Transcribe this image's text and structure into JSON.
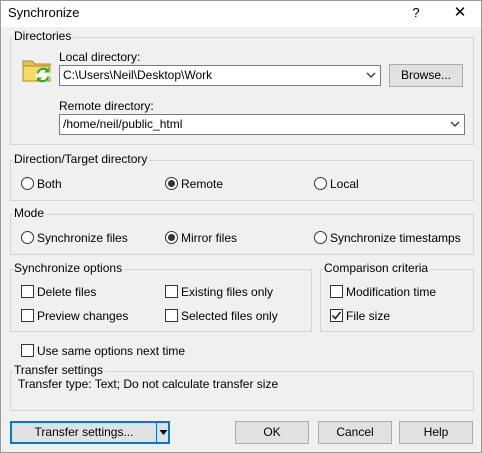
{
  "window": {
    "title": "Synchronize",
    "help_glyph": "?",
    "close_glyph": "✕"
  },
  "directories": {
    "group_label": "Directories",
    "local_label": "Local directory:",
    "local_value": "C:\\Users\\Neil\\Desktop\\Work",
    "browse_label": "Browse...",
    "remote_label": "Remote directory:",
    "remote_value": "/home/neil/public_html"
  },
  "direction": {
    "group_label": "Direction/Target directory",
    "options": [
      {
        "label": "Both",
        "selected": false
      },
      {
        "label": "Remote",
        "selected": true
      },
      {
        "label": "Local",
        "selected": false
      }
    ]
  },
  "mode": {
    "group_label": "Mode",
    "options": [
      {
        "label": "Synchronize files",
        "selected": false
      },
      {
        "label": "Mirror files",
        "selected": true
      },
      {
        "label": "Synchronize timestamps",
        "selected": false
      }
    ]
  },
  "sync_options": {
    "group_label": "Synchronize options",
    "items": [
      {
        "label": "Delete files",
        "checked": false
      },
      {
        "label": "Existing files only",
        "checked": false
      },
      {
        "label": "Preview changes",
        "checked": false
      },
      {
        "label": "Selected files only",
        "checked": false
      }
    ]
  },
  "comparison": {
    "group_label": "Comparison criteria",
    "items": [
      {
        "label": "Modification time",
        "checked": false
      },
      {
        "label": "File size",
        "checked": true
      }
    ]
  },
  "same_options": {
    "label": "Use same options next time",
    "checked": false
  },
  "transfer_settings": {
    "group_label": "Transfer settings",
    "text": "Transfer type: Text; Do not calculate transfer size"
  },
  "footer": {
    "transfer_button": "Transfer settings...",
    "ok": "OK",
    "cancel": "Cancel",
    "help": "Help"
  },
  "icons": {
    "folder": "folder-sync-icon",
    "combo_arrow": "chevron-down-icon"
  },
  "colors": {
    "accent": "#0078d7",
    "folder_yellow": "#f6d96b",
    "sync_green": "#3aa23a"
  }
}
